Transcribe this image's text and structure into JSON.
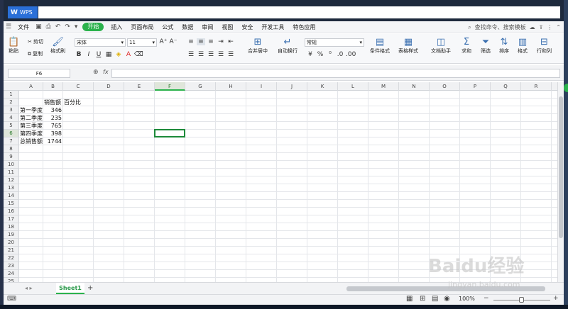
{
  "app": {
    "tab_label": "WPS",
    "logo_glyph": "W"
  },
  "menu": {
    "file_label": "文件",
    "items": [
      "开始",
      "插入",
      "页面布局",
      "公式",
      "数据",
      "审阅",
      "视图",
      "安全",
      "开发工具",
      "特色应用"
    ],
    "active": "开始",
    "search_label": "查找命令、搜索模板"
  },
  "ribbon": {
    "paste": "粘贴",
    "cut": "剪切",
    "copy": "复制",
    "format_painter": "格式刷",
    "font_name": "宋体",
    "font_size": "11",
    "merge_center": "合并居中",
    "wrap_text": "自动换行",
    "number_format": "常规",
    "conditional_format": "条件格式",
    "table_style": "表格样式",
    "doc_helper": "文档助手",
    "sum": "求和",
    "filter": "筛选",
    "sort": "排序",
    "format": "格式",
    "row_col": "行和列"
  },
  "formula_bar": {
    "cell_ref": "F6",
    "fx": "fx",
    "value": ""
  },
  "columns": [
    "A",
    "B",
    "C",
    "D",
    "E",
    "F",
    "G",
    "H",
    "I",
    "J",
    "K",
    "L",
    "M",
    "N",
    "O",
    "P",
    "Q",
    "R"
  ],
  "selected_column": "F",
  "rows": [
    "1",
    "2",
    "3",
    "4",
    "5",
    "6",
    "7",
    "8",
    "9",
    "10",
    "11",
    "12",
    "13",
    "14",
    "15",
    "16",
    "17",
    "18",
    "19",
    "20",
    "21",
    "22",
    "23",
    "24",
    "25"
  ],
  "selected_row": "6",
  "cells": {
    "B2": "销售额",
    "C2": "百分比",
    "A3": "第一季度",
    "B3": "346",
    "A4": "第二季度",
    "B4": "235",
    "A5": "第三季度",
    "B5": "765",
    "A6": "第四季度",
    "B6": "398",
    "A7": "总销售额",
    "B7": "1744"
  },
  "sheets": {
    "active": "Sheet1",
    "add": "+"
  },
  "status": {
    "zoom": "100%"
  },
  "watermark": {
    "main": "Baidu经验",
    "sub": "jingyan.baidu.com"
  }
}
